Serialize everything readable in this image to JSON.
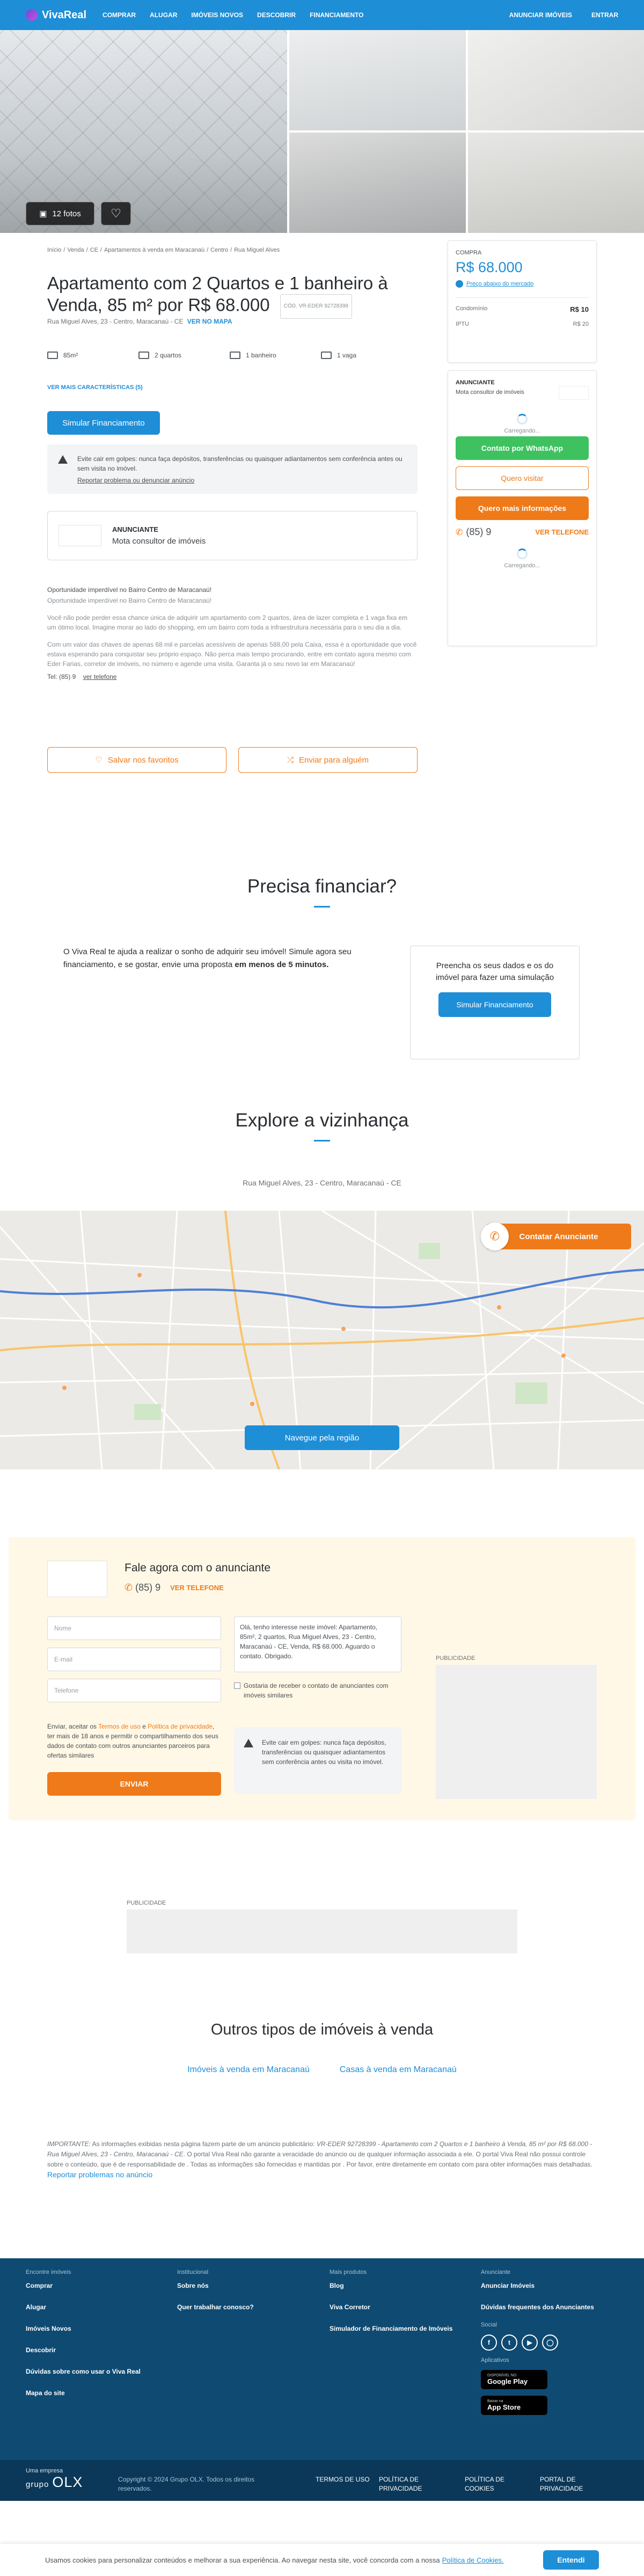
{
  "header": {
    "logo": "VivaReal",
    "nav": [
      "COMPRAR",
      "ALUGAR",
      "IMÓVEIS NOVOS",
      "DESCOBRIR",
      "FINANCIAMENTO"
    ],
    "right": [
      "ANUNCIAR IMÓVEIS",
      "ENTRAR"
    ]
  },
  "gallery": {
    "photos_label": "12 fotos"
  },
  "breadcrumb": [
    "Início",
    "/",
    "Venda",
    "/",
    "CE",
    "/",
    "Apartamentos à venda em Maracanaú",
    "/",
    "Centro",
    "/",
    "Rua Miguel Alves"
  ],
  "listing": {
    "title": "Apartamento com 2 Quartos e 1 banheiro à Venda, 85 m² por R$ 68.000",
    "code": "CÓD. VR-EDER 92728399",
    "address": "Rua Miguel Alves, 23 - Centro, Maracanaú - CE",
    "map_link": "VER NO MAPA",
    "features": [
      "85m²",
      "2 quartos",
      "1 banheiro",
      "1 vaga"
    ],
    "more_features": "VER MAIS CARACTERÍSTICAS (5)",
    "simulate": "Simular Financiamento",
    "warning": "Evite cair em golpes: nunca faça depósitos, transferências ou quaisquer adiantamentos sem conferência antes ou sem visita no imóvel.",
    "report": "Reportar problema ou denunciar anúncio",
    "advertiser_label": "ANUNCIANTE",
    "advertiser_name": "Mota consultor de imóveis",
    "desc": [
      "Oportunidade imperdível no Bairro Centro de Maracanaú!",
      "Oportunidade imperdível no Bairro Centro de Maracanaú!",
      "Você não pode perder essa chance única de adquirir um apartamento com 2 quartos, área de lazer completa e 1 vaga fixa em um ótimo local. Imagine morar ao lado do shopping, em um bairro com toda a infraestrutura necessária para o seu dia a dia.",
      "Com um valor das chaves de apenas 68 mil e parcelas acessíveis de apenas 588,00 pela Caixa, essa é a oportunidade que você estava esperando para conquistar seu próprio espaço. Não perca mais tempo procurando, entre em contato agora mesmo com Eder Farias, corretor de imóveis, no número e agende uma visita. Garanta já o seu novo lar em Maracanaú!"
    ],
    "tel_label": "Tel: (85) 9",
    "tel_link": "ver telefone",
    "save": "Salvar nos favoritos",
    "share": "Enviar para alguém"
  },
  "price_card": {
    "label": "COMPRA",
    "price": "R$ 68.000",
    "below": "Preço abaixo do mercado",
    "rows": [
      {
        "k": "Condomínio",
        "v": "R$ 10"
      },
      {
        "k": "IPTU",
        "v": "R$ 20"
      }
    ]
  },
  "contact_card": {
    "label": "ANUNCIANTE",
    "name": "Mota consultor de imóveis",
    "loading": "Carregando...",
    "whatsapp": "Contato por WhatsApp",
    "visit": "Quero visitar",
    "info": "Quero mais informações",
    "phone": "(85) 9",
    "see_phone": "VER TELEFONE",
    "loading2": "Carregando..."
  },
  "financing": {
    "title": "Precisa financiar?",
    "text": "O Viva Real te ajuda a realizar o sonho de adquirir seu imóvel! Simule agora seu financiamento, e se gostar, envie uma proposta",
    "text_bold": "em menos de 5 minutos.",
    "box": "Preencha os seus dados e os do imóvel para fazer uma simulação",
    "button": "Simular Financiamento"
  },
  "neighborhood": {
    "title": "Explore a vizinhança",
    "address": "Rua Miguel Alves, 23 - Centro, Maracanaú - CE",
    "contact": "Contatar Anunciante",
    "navigate": "Navegue pela região"
  },
  "lead": {
    "title": "Fale agora com o anunciante",
    "phone": "(85) 9",
    "see_phone": "VER TELEFONE",
    "name_ph": "Nome",
    "email_ph": "E-mail",
    "tel_ph": "Telefone",
    "message": "Olá, tenho interesse neste imóvel: Apartamento, 85m², 2 quartos, Rua Miguel Alves, 23 - Centro, Maracanaú - CE, Venda, R$ 68.000. Aguardo o contato. Obrigado.",
    "checkbox": "Gostaria de receber o contato de anunciantes com imóveis similares",
    "terms_pre": "Enviar, aceitar os",
    "terms_link1": "Termos de uso",
    "terms_mid": "e",
    "terms_link2": "Política de privacidade",
    "terms_post": ", ter mais de 18 anos e permitir o compartilhamento dos seus dados de contato com outros anunciantes parceiros para ofertas similares",
    "send": "ENVIAR",
    "warning": "Evite cair em golpes: nunca faça depósitos, transferências ou quaisquer adiantamentos sem conferência antes ou visita no imóvel.",
    "ad_label": "PUBLICIDADE"
  },
  "ad_label": "PUBLICIDADE",
  "other_types": {
    "title": "Outros tipos de imóveis à venda",
    "links": [
      "Imóveis à venda em Maracanaú",
      "Casas à venda em Maracanaú"
    ]
  },
  "disclaimer": {
    "lead": "IMPORTANTE:",
    "text1": "As informações exibidas nesta página fazem parte de um anúncio publicitário:",
    "italic": "VR-EDER 92728399 - Apartamento com 2 Quartos e 1 banheiro à Venda, 85 m² por R$ 68.000 - Rua Miguel Alves, 23 - Centro, Maracanaú - CE",
    "text2": ". O portal Viva Real não garante a veracidade do anúncio ou de qualquer informação associada a ele. O portal Viva Real não possui controle sobre o conteúdo, que é de responsabilidade de . Todas as informações são fornecidas e mantidas por . Por favor, entre diretamente em contato com para obter informações mais detalhadas.",
    "link": "Reportar problemas no anúncio"
  },
  "footer": {
    "cols": [
      {
        "h": "Encontre imóveis",
        "items": [
          "Comprar",
          "Alugar",
          "Imóveis Novos",
          "Descobrir",
          "Dúvidas sobre como usar o Viva Real",
          "Mapa do site"
        ]
      },
      {
        "h": "Institucional",
        "items": [
          "Sobre nós",
          "Quer trabalhar conosco?"
        ]
      },
      {
        "h": "Mais produtos",
        "items": [
          "Blog",
          "Viva Corretor",
          "Simulador de Financiamento de Imóveis"
        ]
      },
      {
        "h": "Anunciante",
        "items": [
          "Anunciar Imóveis",
          "Dúvidas frequentes dos Anunciantes"
        ]
      }
    ],
    "social_label": "Social",
    "apps_label": "Aplicativos",
    "google": {
      "small": "DISPONÍVEL NO",
      "big": "Google Play"
    },
    "apple": {
      "small": "Baixar na",
      "big": "App Store"
    },
    "olx_small": "Uma empresa",
    "olx_grupo": "grupo",
    "olx": "OLX",
    "copyright": "Copyright © 2024 Grupo OLX. Todos os direitos reservados.",
    "links": [
      "TERMOS DE USO",
      "POLÍTICA DE PRIVACIDADE",
      "POLÍTICA DE COOKIES",
      "PORTAL DE PRIVACIDADE"
    ]
  },
  "cookie": {
    "text": "Usamos cookies para personalizar conteúdos e melhorar a sua experiência. Ao navegar nesta site, você concorda com a nossa",
    "link": "Política de Cookies.",
    "button": "Entendi"
  }
}
